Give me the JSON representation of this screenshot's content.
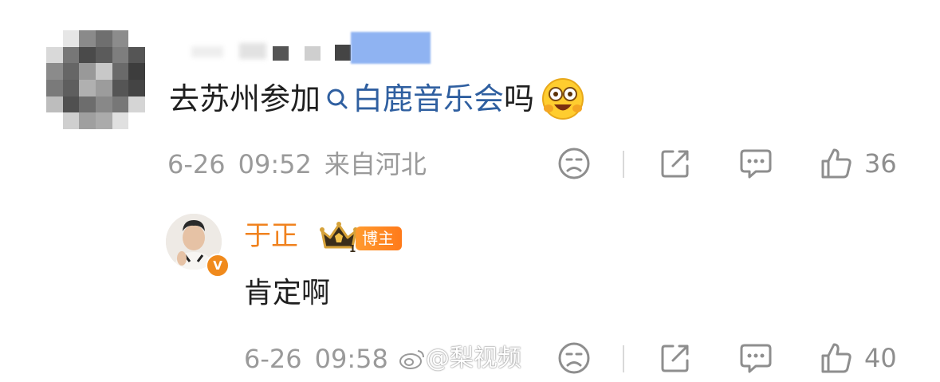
{
  "comment": {
    "text_before": "去苏州参加",
    "topic": "白鹿音乐会",
    "text_after": "吗",
    "date": "6-26",
    "time": "09:52",
    "location": "来自河北",
    "like_count": "36",
    "emoji": "excited-face-emoji"
  },
  "reply": {
    "author": "于正",
    "badge": "博主",
    "crown_level": "1",
    "verify_mark": "V",
    "text": "肯定啊",
    "date": "6-26",
    "time": "09:58",
    "like_count": "40"
  },
  "watermark": {
    "text": "@梨视频"
  },
  "colors": {
    "topic_link": "#2f5fa0",
    "author_orange": "#f0821e",
    "meta_gray": "#9a9a9a"
  },
  "icons": {
    "dislike": "sad-face-icon",
    "share": "share-icon",
    "reply": "comment-bubble-icon",
    "like": "thumbs-up-icon"
  }
}
